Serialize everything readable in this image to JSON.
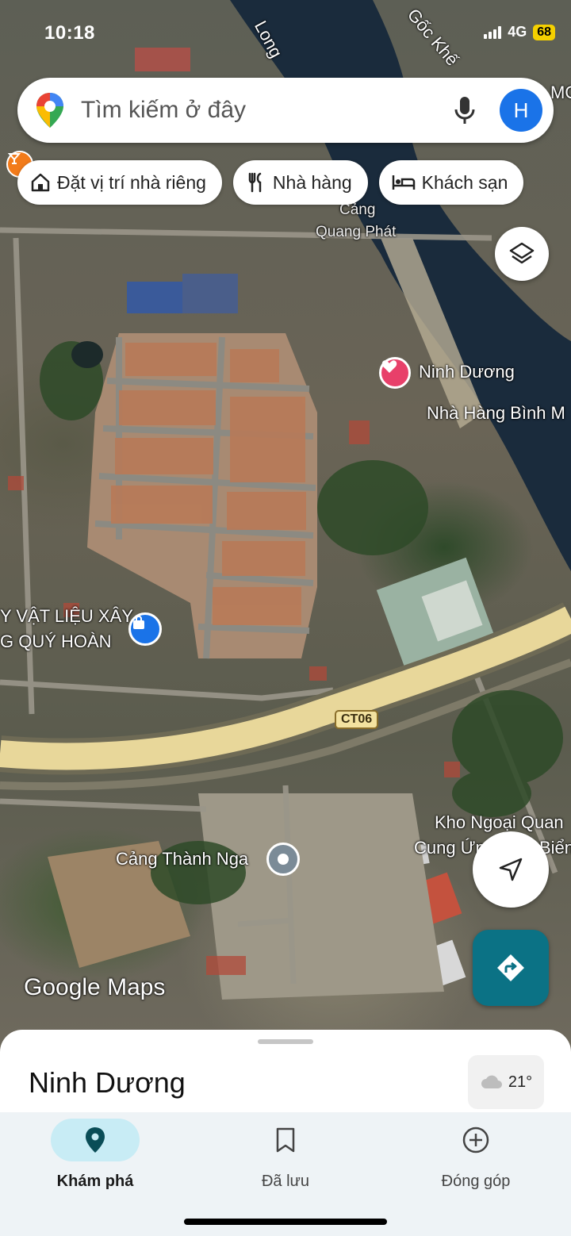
{
  "status_bar": {
    "time": "10:18",
    "network": "4G",
    "battery": "68"
  },
  "search": {
    "placeholder": "Tìm kiếm ở đây",
    "avatar_letter": "H"
  },
  "chips": [
    {
      "label": "Đặt vị trí nhà riêng",
      "icon": "home-icon"
    },
    {
      "label": "Nhà hàng",
      "icon": "restaurant-icon"
    },
    {
      "label": "Khách sạn",
      "icon": "hotel-icon"
    }
  ],
  "map": {
    "labels": {
      "long": "Long",
      "goc_khe": "Gốc Khế",
      "mo": "MO",
      "cang": "Cảng",
      "quang_phat": "Quang Phát",
      "ninh_duong": "Ninh Dương",
      "nha_hang": "Nhà Hàng Bình M",
      "vat_lieu_1": "Y VẬT LIỆU XÂY",
      "vat_lieu_2": "G QUÝ HOÀN",
      "ct06": "CT06",
      "kho_1": "Kho Ngoại Quan",
      "kho_2": "Cung Ứng",
      "bien": "Biển",
      "cang_thanh_nga": "Cảng Thành Nga",
      "ng": "Ng"
    },
    "logo": "Google Maps"
  },
  "sheet": {
    "place_title": "Ninh Dương",
    "temperature": "21°"
  },
  "nav": [
    {
      "label": "Khám phá",
      "icon": "explore-pin-icon",
      "active": true
    },
    {
      "label": "Đã lưu",
      "icon": "bookmark-icon",
      "active": false
    },
    {
      "label": "Đóng góp",
      "icon": "add-circle-icon",
      "active": false
    }
  ],
  "colors": {
    "accent": "#0b7285",
    "active_nav_bg": "#c8ecf5",
    "avatar": "#1a73e8",
    "road": "#e8d79a"
  }
}
